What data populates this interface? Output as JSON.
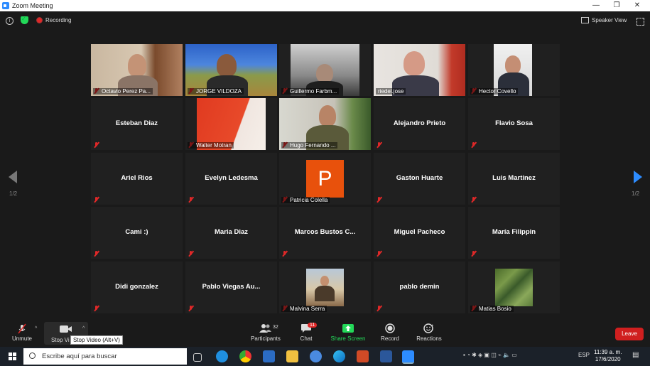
{
  "window": {
    "title": "Zoom Meeting",
    "minimize": "—",
    "restore": "❐",
    "close": "✕"
  },
  "topbar": {
    "recording_label": "Recording",
    "speaker_view_label": "Speaker View"
  },
  "pagination": {
    "left": "1/2",
    "right": "1/2"
  },
  "participants": [
    {
      "name": "Octavio Perez Pa...",
      "video": true
    },
    {
      "name": "JORGE VILDOZA",
      "video": true
    },
    {
      "name": "Guillermo Farbm...",
      "video": true
    },
    {
      "name": "riedel.jose",
      "video": true,
      "speaking": true
    },
    {
      "name": "Hector Covello",
      "video": true
    },
    {
      "name": "Esteban Diaz",
      "video": false
    },
    {
      "name": "Walter Motran",
      "video": true
    },
    {
      "name": "Hugo Fernando ...",
      "video": true
    },
    {
      "name": "Alejandro Prieto",
      "video": false
    },
    {
      "name": "Flavio Sosa",
      "video": false
    },
    {
      "name": "Ariel Rios",
      "video": false
    },
    {
      "name": "Evelyn Ledesma",
      "video": false
    },
    {
      "name": "Patricia Colella",
      "video": false,
      "avatar_letter": "P"
    },
    {
      "name": "Gaston Huarte",
      "video": false
    },
    {
      "name": "Luis Martinez",
      "video": false
    },
    {
      "name": "Cami :)",
      "video": false
    },
    {
      "name": "Maria Diaz",
      "video": false
    },
    {
      "name": "Marcos Bustos C...",
      "video": false
    },
    {
      "name": "Miguel Pacheco",
      "video": false
    },
    {
      "name": "María Filippin",
      "video": false
    },
    {
      "name": "Didi gonzalez",
      "video": false
    },
    {
      "name": "Pablo Viegas Au...",
      "video": false
    },
    {
      "name": "Malvina Serra",
      "video": true
    },
    {
      "name": "pablo demin",
      "video": false
    },
    {
      "name": "Matias Bosio",
      "video": true
    }
  ],
  "toolbar": {
    "unmute": "Unmute",
    "stop_video": "Stop Vi",
    "stop_video_tooltip": "Stop Video (Alt+V)",
    "participants": "Participants",
    "participants_count": "32",
    "chat": "Chat",
    "chat_badge": "11",
    "share_screen": "Share Screen",
    "record": "Record",
    "reactions": "Reactions",
    "leave": "Leave"
  },
  "taskbar": {
    "search_placeholder": "Escribe aquí para buscar",
    "language": "ESP",
    "time": "11:39 a. m.",
    "date": "17/6/2020"
  },
  "colors": {
    "accent_blue": "#2d8cff",
    "leave_red": "#d01f1f",
    "speaking_outline": "#b6e35b",
    "share_green": "#23d959"
  }
}
